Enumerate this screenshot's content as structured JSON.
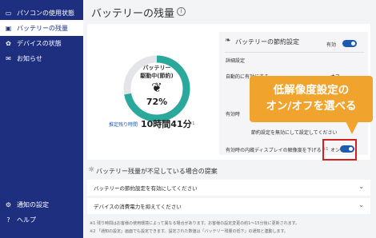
{
  "sidebar": {
    "items": [
      {
        "label": "パソコンの使用状態",
        "icon": "monitor-icon"
      },
      {
        "label": "バッテリーの残量",
        "icon": "battery-icon"
      },
      {
        "label": "デバイスの状態",
        "icon": "gear-icon"
      },
      {
        "label": "お知らせ",
        "icon": "mail-icon"
      }
    ],
    "bottom": [
      {
        "label": "通知の設定",
        "icon": "gear-icon"
      },
      {
        "label": "ヘルプ",
        "icon": "help-icon"
      }
    ]
  },
  "main": {
    "title": "バッテリーの残量",
    "title_info": "i",
    "ring": {
      "line1": "バッテリー",
      "line2": "駆動中(節約)",
      "percent_text": "72%",
      "percent": 72,
      "color": "#2aa89c"
    },
    "estimate": {
      "label": "推定残り時間",
      "value": "10時間41分",
      "note": "※1"
    },
    "saving": {
      "title": "バッテリーの節約設定",
      "status": "有効",
      "detail_heading": "詳細設定",
      "auto_label": "自動的に有効にする",
      "auto_value": "オフ",
      "enabled_prefix": "有効時",
      "disabled_note": "節約設定を無効にして設定してください",
      "dim_label": "有効時の内蔵ディスプレイの解像度を下げる",
      "dim_note": "※1",
      "dim_value": "オン"
    },
    "callout": {
      "line1": "低解像度設定の",
      "line2": "オン/オフを選べる"
    },
    "suggestions": {
      "title": "バッテリー残量が不足している場合の提案",
      "items": [
        "バッテリーの節約設定を有効にしてください",
        "デバイスの消費電力を抑えてください"
      ]
    },
    "footnotes": [
      "※1 残り時間はお客様の使用環境によって異なる場合があります。お客様の設定変更の約1〜15分後に更新されます。",
      "※2 「通知の設定」画面でも設定できます。設定された数値は「バッテリー残量の低下」の通知と連動します。"
    ]
  }
}
